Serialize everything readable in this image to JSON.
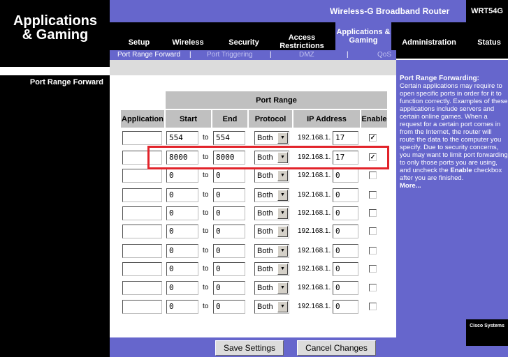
{
  "section_title": "Applications & Gaming",
  "brand": "Wireless-G Broadband Router",
  "model": "WRT54G",
  "nav": {
    "setup": "Setup",
    "wireless": "Wireless",
    "security": "Security",
    "access_restrictions": "Access Restrictions",
    "applications_gaming": "Applications & Gaming",
    "administration": "Administration",
    "status": "Status"
  },
  "subnav": {
    "port_range_forward": "Port Range Forward",
    "port_triggering": "Port Triggering",
    "dmz": "DMZ",
    "qos": "QoS",
    "separator": "|"
  },
  "left_subtitle": "Port Range Forward",
  "table": {
    "group_header": "Port Range",
    "headers": [
      "Application",
      "Start",
      "End",
      "Protocol",
      "IP Address",
      "Enable"
    ],
    "to_label": "to",
    "ip_prefix": "192.168.1.",
    "rows": [
      {
        "app": "",
        "start": "554",
        "end": "554",
        "protocol": "Both",
        "ip": "17",
        "enabled": true
      },
      {
        "app": "",
        "start": "8000",
        "end": "8000",
        "protocol": "Both",
        "ip": "17",
        "enabled": true
      },
      {
        "app": "",
        "start": "0",
        "end": "0",
        "protocol": "Both",
        "ip": "0",
        "enabled": false
      },
      {
        "app": "",
        "start": "0",
        "end": "0",
        "protocol": "Both",
        "ip": "0",
        "enabled": false
      },
      {
        "app": "",
        "start": "0",
        "end": "0",
        "protocol": "Both",
        "ip": "0",
        "enabled": false
      },
      {
        "app": "",
        "start": "0",
        "end": "0",
        "protocol": "Both",
        "ip": "0",
        "enabled": false
      },
      {
        "app": "",
        "start": "0",
        "end": "0",
        "protocol": "Both",
        "ip": "0",
        "enabled": false
      },
      {
        "app": "",
        "start": "0",
        "end": "0",
        "protocol": "Both",
        "ip": "0",
        "enabled": false
      },
      {
        "app": "",
        "start": "0",
        "end": "0",
        "protocol": "Both",
        "ip": "0",
        "enabled": false
      },
      {
        "app": "",
        "start": "0",
        "end": "0",
        "protocol": "Both",
        "ip": "0",
        "enabled": false
      }
    ]
  },
  "buttons": {
    "save": "Save Settings",
    "cancel": "Cancel Changes"
  },
  "help": {
    "title": "Port Range Forwarding:",
    "body_1": "Certain applications may require to open specific ports in order for it to function correctly. Examples of these applications include servers and certain online games. When a request for a certain port comes in from the Internet, the router will route the data to the computer you specify. Due to security concerns, you may want to limit port forwarding to only those ports you are using, and uncheck the",
    "body_bold": "Enable",
    "body_2": "checkbox after you are finished.",
    "more": "More..."
  },
  "logo": "Cisco Systems",
  "colors": {
    "accent": "#6666cc",
    "highlight": "#e2232a",
    "header_gray": "#c0c0c0"
  }
}
